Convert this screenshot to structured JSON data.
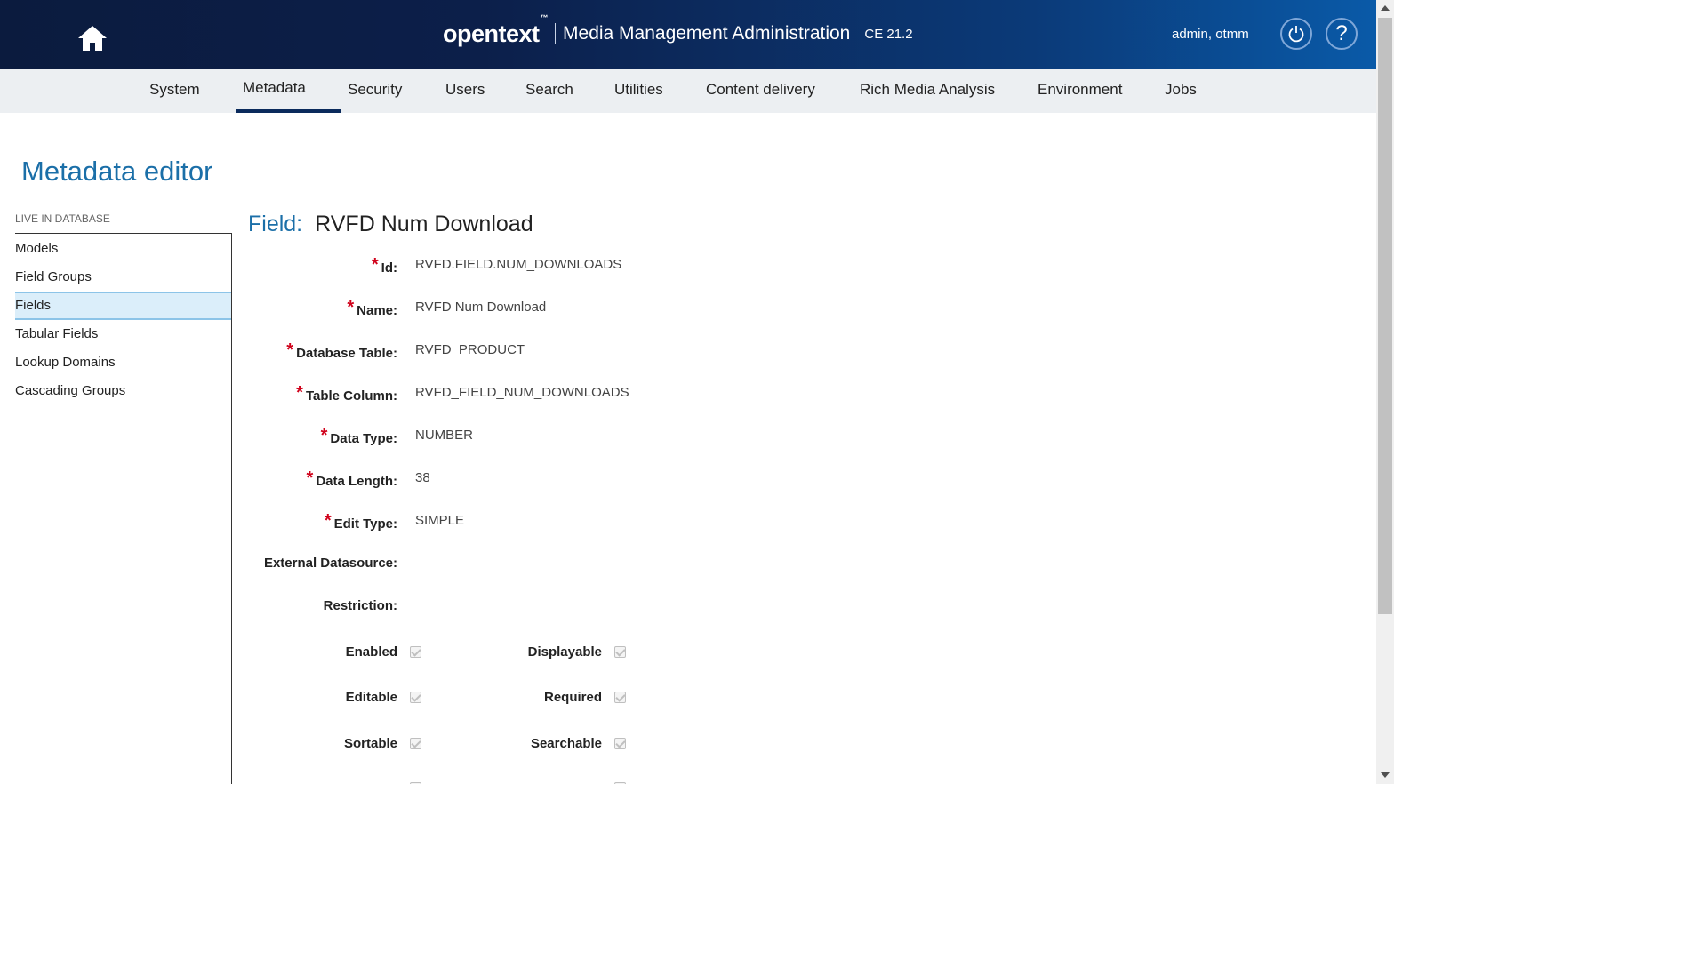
{
  "header": {
    "brand_logo": "opentext",
    "brand_tm": "™",
    "app_title": "Media Management Administration",
    "version": "CE 21.2",
    "user": "admin, otmm",
    "help_symbol": "?",
    "background_start": "#0b1b3e",
    "background_end": "#0a5aa8"
  },
  "nav": {
    "items": [
      {
        "label": "System"
      },
      {
        "label": "Metadata",
        "active": true
      },
      {
        "label": "Security"
      },
      {
        "label": "Users"
      },
      {
        "label": "Search"
      },
      {
        "label": "Utilities"
      },
      {
        "label": "Content delivery"
      },
      {
        "label": "Rich Media Analysis"
      },
      {
        "label": "Environment"
      },
      {
        "label": "Jobs"
      }
    ]
  },
  "page": {
    "title": "Metadata editor"
  },
  "sidebar": {
    "section_label": "LIVE IN DATABASE",
    "items": [
      {
        "label": "Models"
      },
      {
        "label": "Field Groups"
      },
      {
        "label": "Fields",
        "active": true
      },
      {
        "label": "Tabular Fields"
      },
      {
        "label": "Lookup Domains"
      },
      {
        "label": "Cascading Groups"
      }
    ]
  },
  "field": {
    "heading_label": "Field:",
    "heading_value": "RVFD Num Download",
    "required_mark": "*",
    "properties": [
      {
        "key": "Id:",
        "value": "RVFD.FIELD.NUM_DOWNLOADS",
        "required": true
      },
      {
        "key": "Name:",
        "value": "RVFD Num Download",
        "required": true
      },
      {
        "key": "Database Table:",
        "value": "RVFD_PRODUCT",
        "required": true
      },
      {
        "key": "Table Column:",
        "value": "RVFD_FIELD_NUM_DOWNLOADS",
        "required": true
      },
      {
        "key": "Data Type:",
        "value": "NUMBER",
        "required": true
      },
      {
        "key": "Data Length:",
        "value": "38",
        "required": true
      },
      {
        "key": "Edit Type:",
        "value": "SIMPLE",
        "required": true
      },
      {
        "key": "External Datasource:",
        "value": "",
        "required": false
      },
      {
        "key": "Restriction:",
        "value": "",
        "required": false
      }
    ],
    "flags": [
      {
        "left": {
          "label": "Enabled",
          "checked": true
        },
        "right": {
          "label": "Displayable",
          "checked": true
        }
      },
      {
        "left": {
          "label": "Editable",
          "checked": true
        },
        "right": {
          "label": "Required",
          "checked": true
        }
      },
      {
        "left": {
          "label": "Sortable",
          "checked": true
        },
        "right": {
          "label": "Searchable",
          "checked": true
        }
      }
    ]
  },
  "colors": {
    "accent": "#1b6fa8",
    "required": "#d0021b",
    "nav_background": "#eceff2",
    "active_nav_underline": "#0a2a5c",
    "sidebar_active_bg": "#dbeefa"
  }
}
